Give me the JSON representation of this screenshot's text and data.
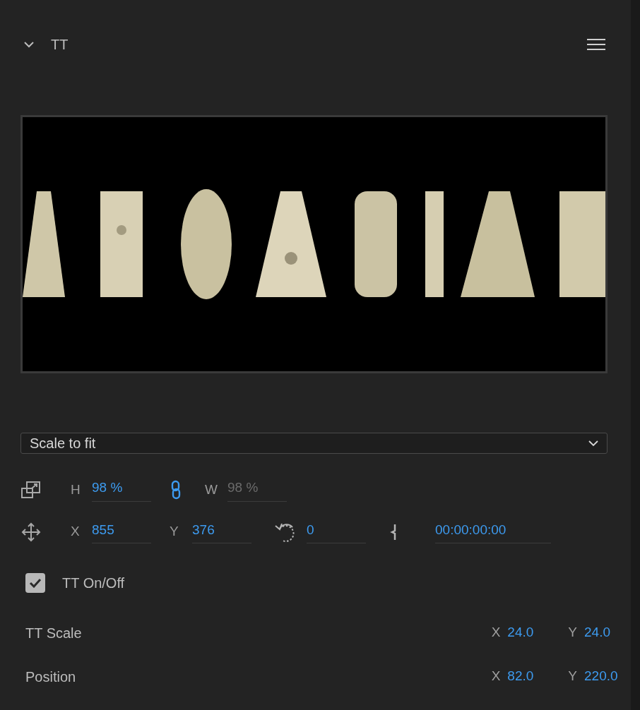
{
  "section": {
    "title": "TT",
    "expanded": true
  },
  "fit_dropdown": {
    "value": "Scale to fit"
  },
  "scale": {
    "h_label": "H",
    "h_value": "98 %",
    "linked": true,
    "w_label": "W",
    "w_value": "98 %"
  },
  "transform": {
    "x_label": "X",
    "x_value": "855",
    "y_label": "Y",
    "y_value": "376",
    "rotation": "0",
    "time": "00:00:00:00"
  },
  "toggle": {
    "label": "TT On/Off",
    "checked": true
  },
  "properties": [
    {
      "name": "TT Scale",
      "x_label": "X",
      "x_value": "24.0",
      "y_label": "Y",
      "y_value": "24.0"
    },
    {
      "name": "Position",
      "x_label": "X",
      "x_value": "82.0",
      "y_label": "Y",
      "y_value": "220.0"
    }
  ]
}
